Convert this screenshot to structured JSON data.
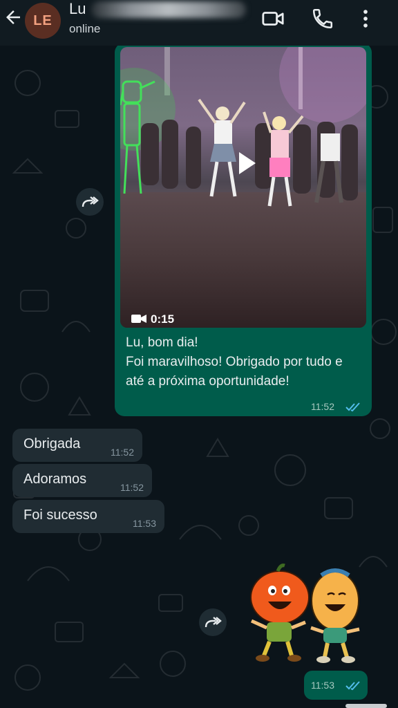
{
  "header": {
    "avatar_initials": "LE",
    "contact_name": "Lu",
    "status": "online",
    "icons": [
      "back-arrow-icon",
      "video-call-icon",
      "voice-call-icon",
      "more-options-icon"
    ]
  },
  "messages": {
    "video_message": {
      "duration": "0:15",
      "text": "Lu, bom dia!\nFoi maravilhoso! Obrigado por tudo e até a próxima oportunidade!",
      "time": "11:52"
    },
    "incoming": [
      {
        "text": "Obrigada",
        "time": "11:52"
      },
      {
        "text": "Adoramos",
        "time": "11:52"
      },
      {
        "text": "Foi sucesso",
        "time": "11:53"
      }
    ],
    "sticker_message": {
      "time": "11:53"
    }
  },
  "colors": {
    "background": "#0b141a",
    "outgoing_bubble": "#005c4b",
    "incoming_bubble": "#202c33",
    "read_ticks": "#53bdeb"
  }
}
